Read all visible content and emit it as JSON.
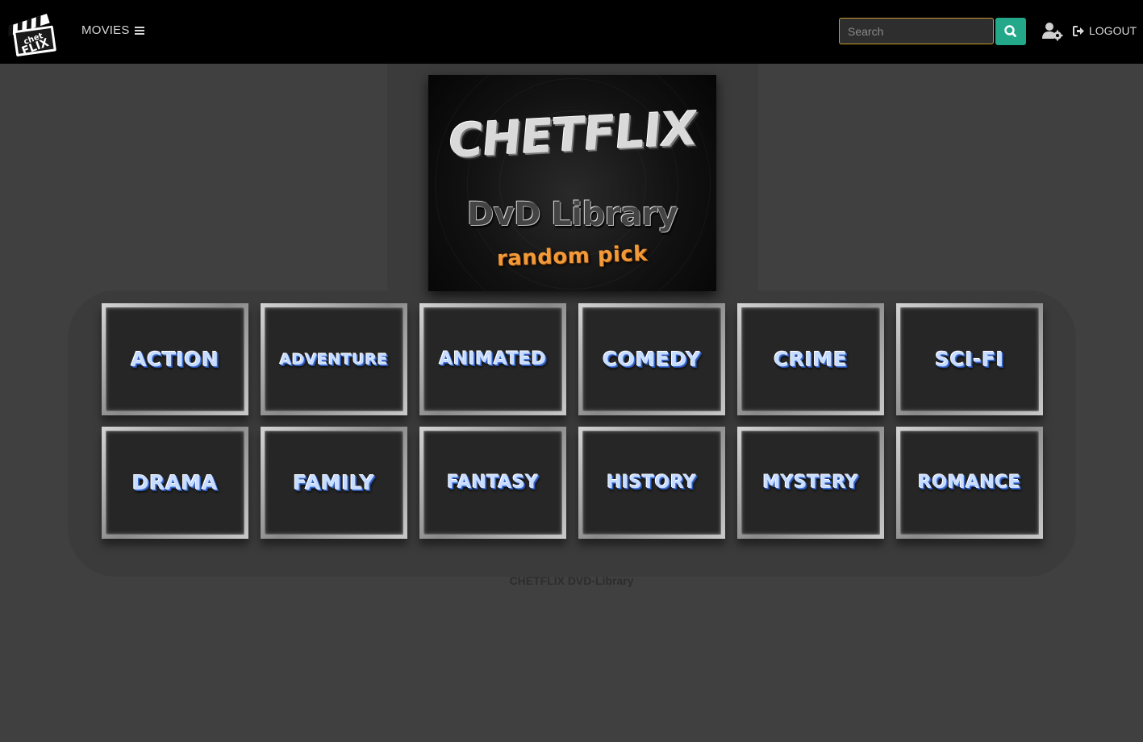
{
  "navbar": {
    "logo_alt": "chet FLIX",
    "movies_label": "MOVIES",
    "search_placeholder": "Search",
    "logout_label": "LOGOUT"
  },
  "banner": {
    "title": "CHETFLIX",
    "subtitle": "DvD Library",
    "tagline": "random pick"
  },
  "genres": [
    {
      "label": "ACTION"
    },
    {
      "label": "ADVENTURE"
    },
    {
      "label": "ANIMATED"
    },
    {
      "label": "COMEDY"
    },
    {
      "label": "CRIME"
    },
    {
      "label": "SCI-FI"
    },
    {
      "label": "DRAMA"
    },
    {
      "label": "FAMILY"
    },
    {
      "label": "FANTASY"
    },
    {
      "label": "HISTORY"
    },
    {
      "label": "MYSTERY"
    },
    {
      "label": "ROMANCE"
    }
  ],
  "footer": {
    "text": "CHETFLIX DVD-Library"
  },
  "colors": {
    "page_background": "#404040",
    "navbar_background": "#000000",
    "search_border": "#c79a2c",
    "search_button": "#23a88a",
    "genre_text": "#c7dcff",
    "tagline": "#f29a3a"
  },
  "icons": {
    "hamburger": "bars-icon",
    "search": "search-icon",
    "user_settings": "user-cog-icon",
    "logout": "sign-out-icon"
  }
}
